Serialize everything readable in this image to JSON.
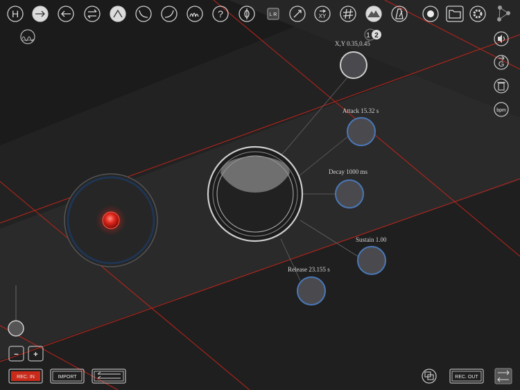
{
  "toolbar": {
    "buttons": [
      {
        "name": "help-h-button",
        "icon": "letter-h-icon",
        "text": "H"
      },
      {
        "name": "arrow-right-button",
        "icon": "arrow-right-icon"
      },
      {
        "name": "arrow-left-button",
        "icon": "arrow-left-icon"
      },
      {
        "name": "swap-arrows-button",
        "icon": "swap-arrows-icon"
      },
      {
        "name": "triangle-envelope-button",
        "icon": "triangle-envelope-icon"
      },
      {
        "name": "decay-curve-button",
        "icon": "decay-curve-icon"
      },
      {
        "name": "rise-curve-button",
        "icon": "rise-curve-icon"
      },
      {
        "name": "waveform-button",
        "icon": "waveform-icon"
      },
      {
        "name": "question-button",
        "icon": "question-icon",
        "text": "?"
      },
      {
        "name": "phase-button",
        "icon": "phase-icon"
      },
      {
        "name": "lr-button",
        "icon": "lr-icon",
        "text": "L R"
      },
      {
        "name": "compass-button",
        "icon": "compass-icon"
      },
      {
        "name": "xy-button",
        "icon": "xy-icon",
        "text": "XY"
      },
      {
        "name": "grid-sharp-button",
        "icon": "grid-sharp-icon"
      },
      {
        "name": "mountain-button",
        "icon": "mountain-icon"
      },
      {
        "name": "metronome-button",
        "icon": "metronome-icon"
      },
      {
        "name": "record-button",
        "icon": "record-icon"
      },
      {
        "name": "folder-button",
        "icon": "folder-icon"
      },
      {
        "name": "settings-button",
        "icon": "gear-icon"
      }
    ]
  },
  "page_indicator": {
    "page1": "1",
    "page2": "2"
  },
  "envelope": {
    "xy_label": "X,Y  0.35,0.45",
    "attack_label": "Attack 15.32 s",
    "decay_label": "Decay 1000 ms",
    "sustain_label": "Sustain 1.00",
    "release_label": "Release  23.155 s"
  },
  "side_buttons": {
    "bpm": "bpm"
  },
  "bottom": {
    "minus": "−",
    "plus": "+",
    "rec_in": "REC. IN",
    "import": "IMPORT",
    "rec_out": "REC. OUT"
  },
  "colors": {
    "accent_red": "#d12a1c",
    "knob_ring_blue": "#4a78b8",
    "background": "#1b1b1b"
  }
}
